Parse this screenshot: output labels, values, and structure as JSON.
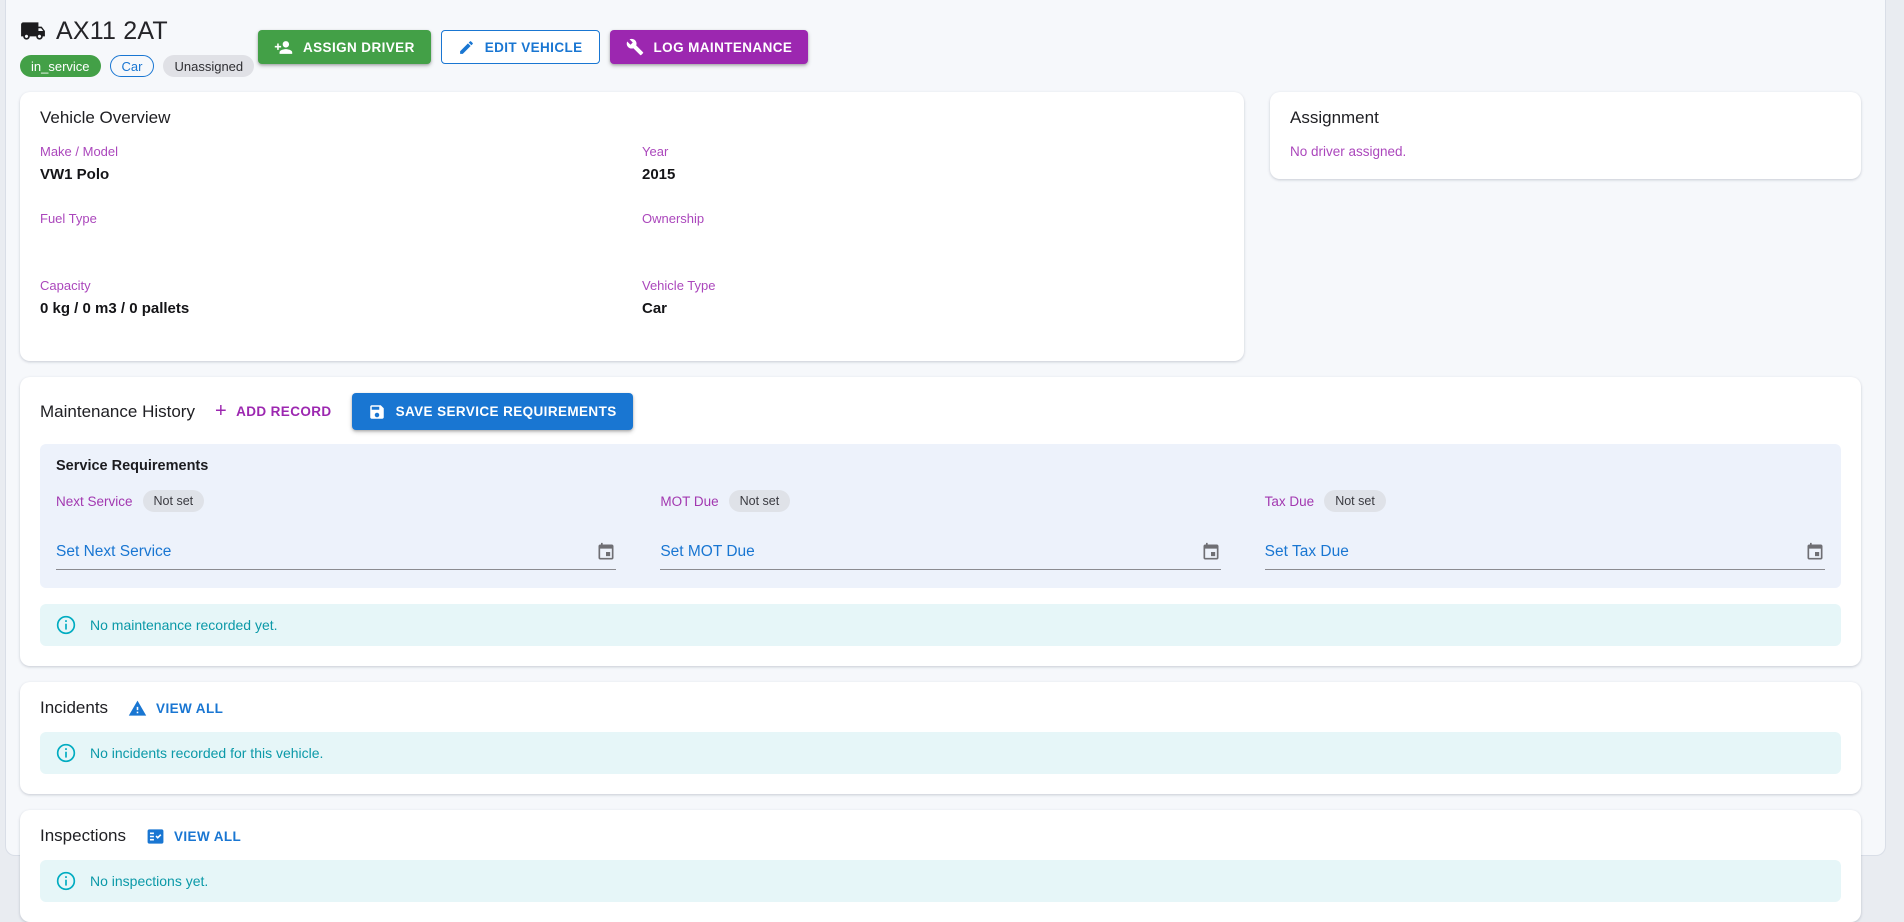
{
  "header": {
    "title": "AX11 2AT",
    "badges": [
      {
        "label": "in_service",
        "variant": "green"
      },
      {
        "label": "Car",
        "variant": "outline-blue"
      },
      {
        "label": "Unassigned",
        "variant": "gray"
      }
    ],
    "actions": {
      "assign_driver": "ASSIGN DRIVER",
      "edit_vehicle": "EDIT VEHICLE",
      "log_maintenance": "LOG MAINTENANCE"
    }
  },
  "overview": {
    "title": "Vehicle Overview",
    "fields": [
      {
        "label": "Make / Model",
        "value": "VW1 Polo"
      },
      {
        "label": "Year",
        "value": "2015"
      },
      {
        "label": "Fuel Type",
        "value": ""
      },
      {
        "label": "Ownership",
        "value": ""
      },
      {
        "label": "Capacity",
        "value": "0 kg / 0 m3 / 0 pallets"
      },
      {
        "label": "Vehicle Type",
        "value": "Car"
      }
    ]
  },
  "assignment": {
    "title": "Assignment",
    "empty_text": "No driver assigned."
  },
  "maintenance": {
    "title": "Maintenance History",
    "add_record_label": "ADD RECORD",
    "save_requirements_label": "SAVE SERVICE REQUIREMENTS",
    "service_requirements": {
      "title": "Service Requirements",
      "items": [
        {
          "label": "Next Service",
          "status": "Not set",
          "action_label": "Set Next Service"
        },
        {
          "label": "MOT Due",
          "status": "Not set",
          "action_label": "Set MOT Due"
        },
        {
          "label": "Tax Due",
          "status": "Not set",
          "action_label": "Set Tax Due"
        }
      ]
    },
    "empty_text": "No maintenance recorded yet."
  },
  "incidents": {
    "title": "Incidents",
    "view_all_label": "VIEW ALL",
    "empty_text": "No incidents recorded for this vehicle."
  },
  "inspections": {
    "title": "Inspections",
    "view_all_label": "VIEW ALL",
    "empty_text": "No inspections yet."
  },
  "colors": {
    "accent_green": "#43a047",
    "accent_blue": "#1976d2",
    "accent_purple": "#9c27b0",
    "label_purple": "#ab47bc",
    "info_icon_teal": "#00acc1",
    "info_text_teal": "#0b99a8",
    "info_bg": "#e6f6f8",
    "requirements_panel_bg": "#edf2fb"
  }
}
